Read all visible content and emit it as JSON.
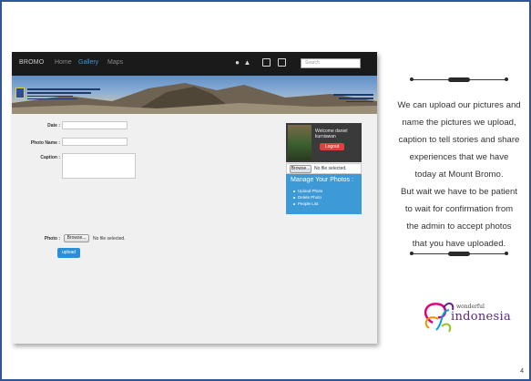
{
  "site": {
    "brand": "BROMO",
    "nav": [
      "Home",
      "Gallery",
      "Maps"
    ],
    "search_placeholder": "Search"
  },
  "form": {
    "date_label": "Date :",
    "photo_name_label": "Photo Name :",
    "caption_label": "Caption :",
    "photo_label": "Photo :",
    "browse_label": "Browse...",
    "no_file_text": "No file selected.",
    "upload_label": "upload"
  },
  "profile": {
    "welcome_line1": "Welcome daniel",
    "welcome_line2": "kurniawan",
    "logout_label": "Logout",
    "browse_label": "Browse...",
    "no_file_text": "No file selected."
  },
  "manage": {
    "title": "Manage Your Photos :",
    "items": [
      "Upload Photo",
      "Delete Photo",
      "People List"
    ]
  },
  "caption_lines": [
    "We can upload our pictures and",
    "name the pictures we upload,",
    "caption to tell stories and share",
    "experiences that we have",
    "today at Mount Bromo.",
    "But wait we have to be patient",
    "to wait for confirmation from",
    "the admin to accept photos",
    "that you have uploaded."
  ],
  "logo": {
    "line1": "wonderful",
    "line2": "indonesia"
  },
  "page_number": "4"
}
